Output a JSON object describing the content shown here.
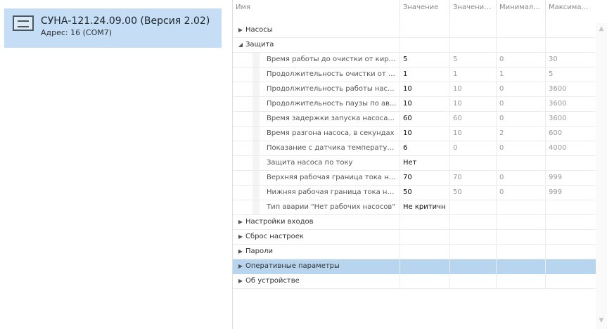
{
  "device": {
    "title": "СУНА-121.24.09.00 (Версия 2.02)",
    "address": "Адрес: 16 (COM7)"
  },
  "grid": {
    "columns": [
      "Имя",
      "Значение",
      "Значение...",
      "Минимал...",
      "Максима..."
    ],
    "categories": {
      "pumps": "Насосы",
      "protection": "Защита",
      "inputs": "Настройки входов",
      "reset": "Сброс настроек",
      "passwords": "Пароли",
      "operational": "Оперативные параметры",
      "about": "Об устройстве"
    },
    "protection_rows": [
      {
        "name": "Время работы до очистки от кир...",
        "value": "5",
        "default": "5",
        "min": "0",
        "max": "30"
      },
      {
        "name": "Продолжительность очистки от к...",
        "value": "1",
        "default": "1",
        "min": "1",
        "max": "5"
      },
      {
        "name": "Продолжительность  работы нас...",
        "value": "10",
        "default": "10",
        "min": "0",
        "max": "3600"
      },
      {
        "name": "Продолжительность паузы по ав...",
        "value": "10",
        "default": "10",
        "min": "0",
        "max": "3600"
      },
      {
        "name": "Время задержки запуска насоса...",
        "value": "60",
        "default": "60",
        "min": "0",
        "max": "3600"
      },
      {
        "name": "Время разгона насоса, в секундах",
        "value": "10",
        "default": "10",
        "min": "2",
        "max": "600"
      },
      {
        "name": "Показание с датчика температур...",
        "value": "6",
        "default": "0",
        "min": "0",
        "max": "4000"
      },
      {
        "name": "Защита насоса по току",
        "value": "Нет",
        "default": "",
        "min": "",
        "max": ""
      },
      {
        "name": "Верхняя рабочая граница тока на...",
        "value": "70",
        "default": "70",
        "min": "0",
        "max": "999"
      },
      {
        "name": "Нижняя рабочая граница тока на...",
        "value": "50",
        "default": "50",
        "min": "0",
        "max": "999"
      },
      {
        "name": "Тип аварии \"Нет рабочих насосов\"",
        "value": "Не критичн",
        "default": "",
        "min": "",
        "max": ""
      }
    ]
  },
  "scrollbar": {
    "up": "▲",
    "down": "▼"
  }
}
